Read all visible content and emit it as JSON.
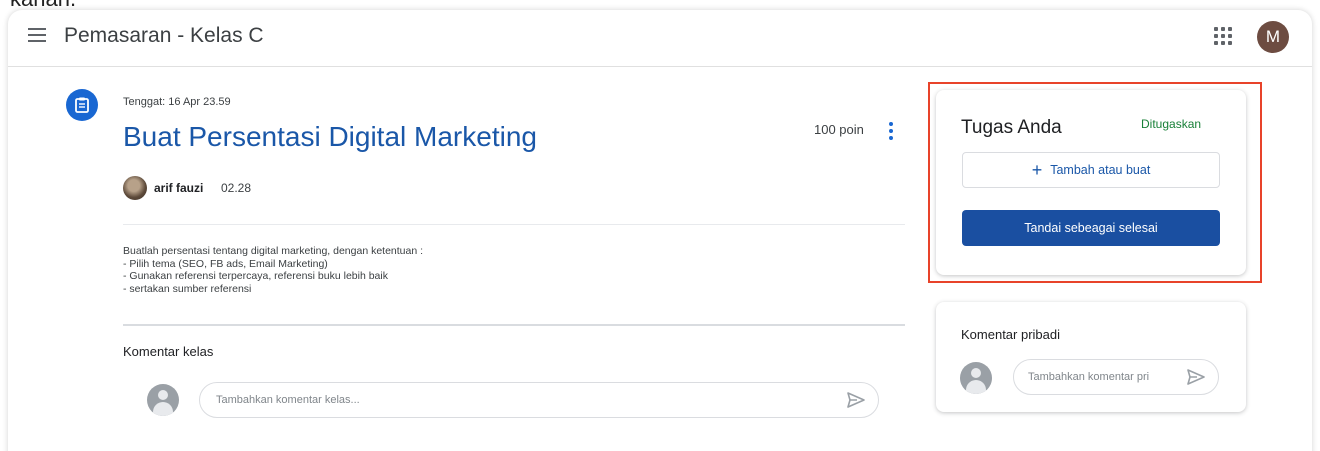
{
  "cropped_top_text": "kanan.",
  "header": {
    "title": "Pemasaran - Kelas C",
    "avatar_initial": "M"
  },
  "assignment": {
    "due": "Tenggat: 16 Apr 23.59",
    "title": "Buat Persentasi Digital Marketing",
    "points": "100 poin",
    "author": "arif fauzi",
    "time": "02.28",
    "description": [
      "Buatlah persentasi tentang digital marketing, dengan ketentuan :",
      "- Pilih tema (SEO, FB ads, Email Marketing)",
      "- Gunakan referensi terpercaya, referensi buku lebih baik",
      "- sertakan sumber referensi"
    ]
  },
  "class_comments": {
    "label": "Komentar kelas",
    "placeholder": "Tambahkan komentar kelas..."
  },
  "your_work": {
    "title": "Tugas Anda",
    "status": "Ditugaskan",
    "add_label": "Tambah atau buat",
    "done_label": "Tandai sebeagai selesai"
  },
  "private_comments": {
    "label": "Komentar pribadi",
    "placeholder": "Tambahkan komentar pri"
  },
  "colors": {
    "accent": "#1967d2",
    "title_blue": "#1a57a8",
    "status_green": "#188038",
    "highlight_red": "#e8432a",
    "button_blue": "#1a4fa1"
  },
  "icons": [
    "menu-icon",
    "apps-icon",
    "assignment-icon",
    "more-vert-icon",
    "plus-icon",
    "send-icon"
  ]
}
